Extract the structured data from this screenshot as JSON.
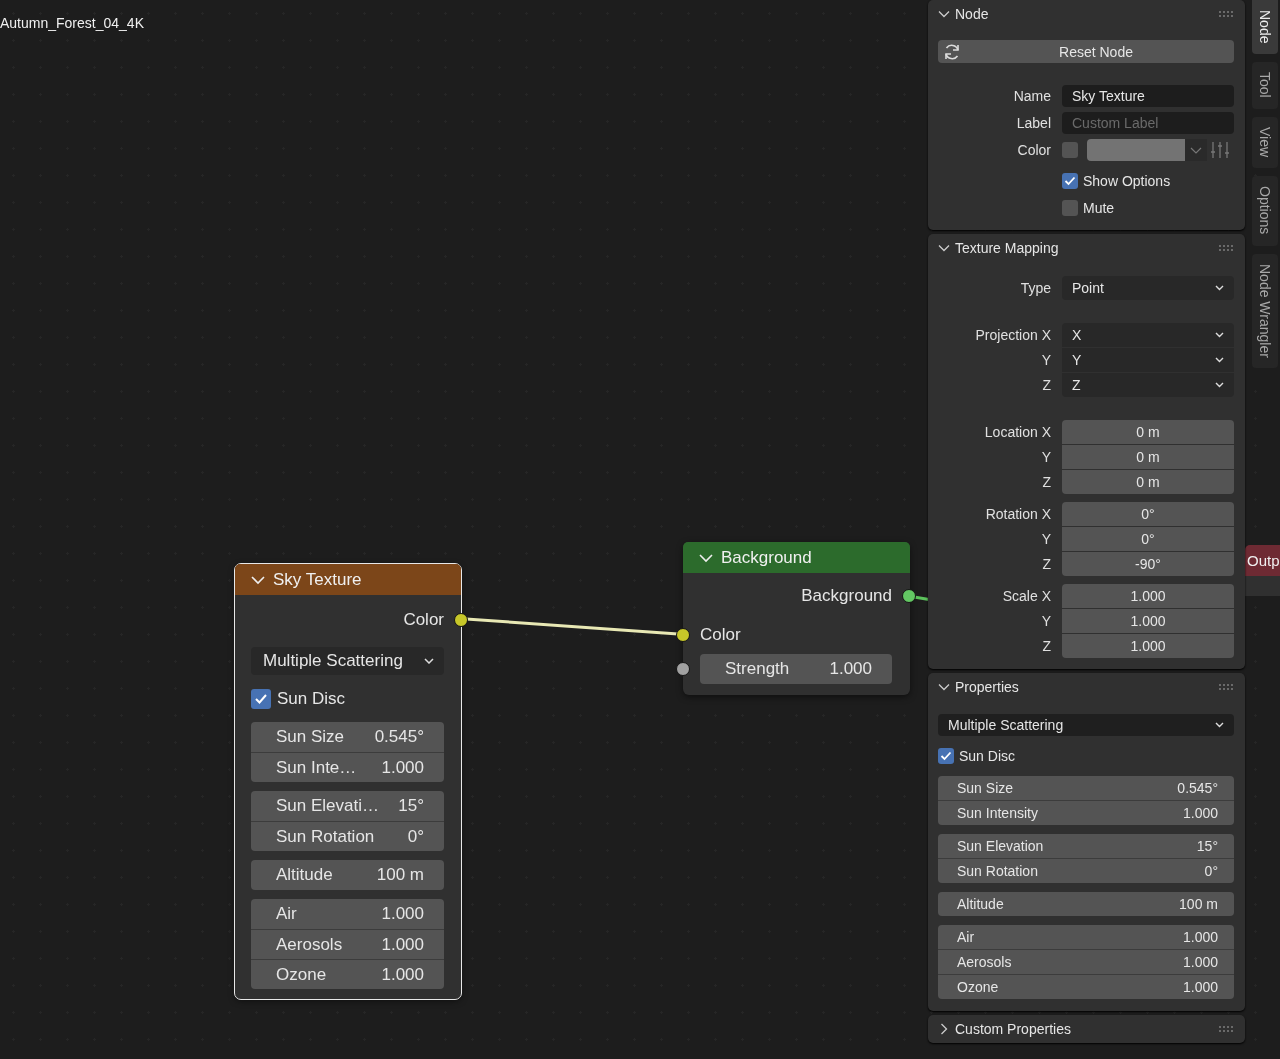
{
  "editor": {
    "title": "Autumn_Forest_04_4K"
  },
  "nodes": [
    {
      "kind": "sky",
      "title": "Sky Texture",
      "color": "#7c4619",
      "selected": true,
      "expanded": true,
      "outputs": [
        {
          "label": "Color",
          "color": "#c7c729"
        }
      ],
      "dropdown": {
        "value": "Multiple Scattering"
      },
      "checkbox": {
        "label": "Sun Disc",
        "checked": true
      },
      "field_groups": [
        [
          {
            "label": "Sun Size",
            "value": "0.545°"
          },
          {
            "label": "Sun Inte…",
            "value": "1.000"
          }
        ],
        [
          {
            "label": "Sun Elevati…",
            "value": "15°"
          },
          {
            "label": "Sun Rotation",
            "value": "0°"
          }
        ],
        [
          {
            "label": "Altitude",
            "value": "100 m"
          }
        ],
        [
          {
            "label": "Air",
            "value": "1.000"
          },
          {
            "label": "Aerosols",
            "value": "1.000"
          },
          {
            "label": "Ozone",
            "value": "1.000"
          }
        ]
      ]
    },
    {
      "kind": "background",
      "title": "Background",
      "color": "#2c6b2c",
      "selected": false,
      "expanded": true,
      "outputs": [
        {
          "label": "Background",
          "color": "#63c763"
        }
      ],
      "inputs": [
        {
          "kind": "socket",
          "label": "Color",
          "color": "#c7c729"
        },
        {
          "kind": "field",
          "label": "Strength",
          "value": "1.000",
          "color": "#a1a1a1"
        }
      ]
    },
    {
      "kind": "output",
      "title": "Outp",
      "color": "#6e2a33",
      "selected": false
    }
  ],
  "panels": [
    {
      "kind": "node",
      "title": "Node",
      "expanded": true,
      "reset_button": "Reset Node",
      "name": {
        "label": "Name",
        "value": "Sky Texture"
      },
      "label_field": {
        "label": "Label",
        "placeholder": "Custom Label"
      },
      "color": {
        "label": "Color",
        "checked": false
      },
      "options": [
        {
          "label": "Show Options",
          "checked": true
        },
        {
          "label": "Mute",
          "checked": false
        }
      ]
    },
    {
      "kind": "texture_mapping",
      "title": "Texture Mapping",
      "expanded": true,
      "groups": [
        {
          "kind": "dropdown",
          "rows": [
            {
              "label": "Type",
              "value": "Point"
            }
          ]
        },
        {
          "kind": "dropdown",
          "rows": [
            {
              "label": "Projection X",
              "value": "X"
            },
            {
              "label": "Y",
              "value": "Y"
            },
            {
              "label": "Z",
              "value": "Z"
            }
          ]
        },
        {
          "kind": "number",
          "rows": [
            {
              "label": "Location X",
              "value": "0 m"
            },
            {
              "label": "Y",
              "value": "0 m"
            },
            {
              "label": "Z",
              "value": "0 m"
            }
          ]
        },
        {
          "kind": "number",
          "rows": [
            {
              "label": "Rotation X",
              "value": "0°"
            },
            {
              "label": "Y",
              "value": "0°"
            },
            {
              "label": "Z",
              "value": "-90°"
            }
          ]
        },
        {
          "kind": "number",
          "rows": [
            {
              "label": "Scale X",
              "value": "1.000"
            },
            {
              "label": "Y",
              "value": "1.000"
            },
            {
              "label": "Z",
              "value": "1.000"
            }
          ]
        }
      ]
    },
    {
      "kind": "properties",
      "title": "Properties",
      "expanded": true,
      "dropdown": "Multiple Scattering",
      "checkbox": {
        "label": "Sun Disc",
        "checked": true
      },
      "field_groups": [
        [
          {
            "label": "Sun Size",
            "value": "0.545°"
          },
          {
            "label": "Sun Intensity",
            "value": "1.000"
          }
        ],
        [
          {
            "label": "Sun Elevation",
            "value": "15°"
          },
          {
            "label": "Sun Rotation",
            "value": "0°"
          }
        ],
        [
          {
            "label": "Altitude",
            "value": "100 m"
          }
        ],
        [
          {
            "label": "Air",
            "value": "1.000"
          },
          {
            "label": "Aerosols",
            "value": "1.000"
          },
          {
            "label": "Ozone",
            "value": "1.000"
          }
        ]
      ]
    },
    {
      "kind": "custom",
      "title": "Custom Properties",
      "expanded": false
    }
  ],
  "tabs": [
    {
      "label": "Node",
      "selected": true
    },
    {
      "label": "Tool",
      "selected": false
    },
    {
      "label": "View",
      "selected": false
    },
    {
      "label": "Options",
      "selected": false
    },
    {
      "label": "Node Wrangler",
      "selected": false
    }
  ]
}
